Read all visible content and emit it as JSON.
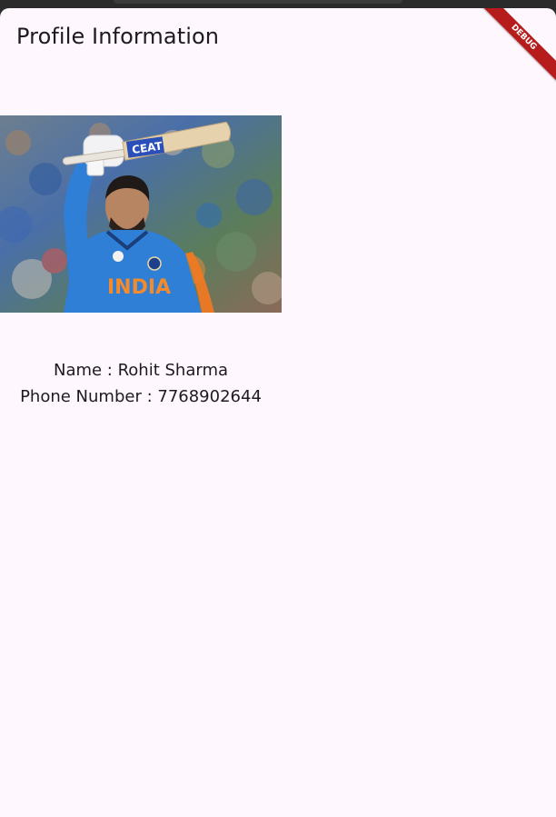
{
  "app_bar": {
    "title": "Profile Information"
  },
  "debug_banner": {
    "label": "DEBUG"
  },
  "profile": {
    "name_line": "Name : Rohit Sharma",
    "phone_line": "Phone Number : 7768902644"
  },
  "photo": {
    "bat_text": "CEAT",
    "jersey_text": "INDIA"
  },
  "colors": {
    "background": "#fef7fd",
    "banner": "#b71c1c",
    "jersey": "#2f7fd6",
    "text": "#1d1b20"
  }
}
